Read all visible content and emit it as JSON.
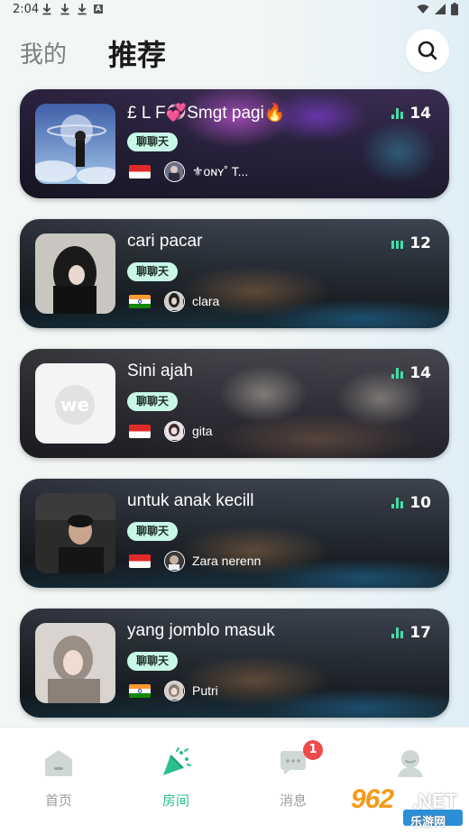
{
  "status_bar": {
    "time": "2:04",
    "notification_icons": [
      "download-icon",
      "download-icon",
      "download-icon",
      "a-icon"
    ],
    "right_icons": [
      "wifi-icon",
      "signal-icon",
      "battery-icon"
    ]
  },
  "header": {
    "tab_mine": "我的",
    "tab_recommend": "推荐",
    "search_icon": "search-icon"
  },
  "rooms": [
    {
      "name": "£ L F💞Smgt pagi🔥",
      "tag": "聊聊天",
      "country": "Indonesia",
      "host": "⚜ᴏɴʏ˚ T...",
      "count": "14"
    },
    {
      "name": "cari pacar",
      "tag": "聊聊天",
      "country": "India",
      "host": "clara",
      "count": "12"
    },
    {
      "name": "Sini ajah",
      "tag": "聊聊天",
      "country": "Indonesia",
      "host": "gita",
      "count": "14"
    },
    {
      "name": "untuk anak kecill",
      "tag": "聊聊天",
      "country": "Indonesia",
      "host": "Zara nerenn",
      "count": "10"
    },
    {
      "name": "yang jomblo masuk",
      "tag": "聊聊天",
      "country": "India",
      "host": "Putri",
      "count": "17"
    }
  ],
  "nav": {
    "home": "首页",
    "rooms": "房间",
    "messages": "消息",
    "messages_badge": "1",
    "profile": ""
  },
  "watermark": {
    "brand": "962",
    "suffix": ".NET",
    "sub": "乐游网"
  },
  "colors": {
    "accent": "#2bbf8e",
    "tag_bg": "#c8f7e8",
    "badge": "#f04a4a"
  }
}
